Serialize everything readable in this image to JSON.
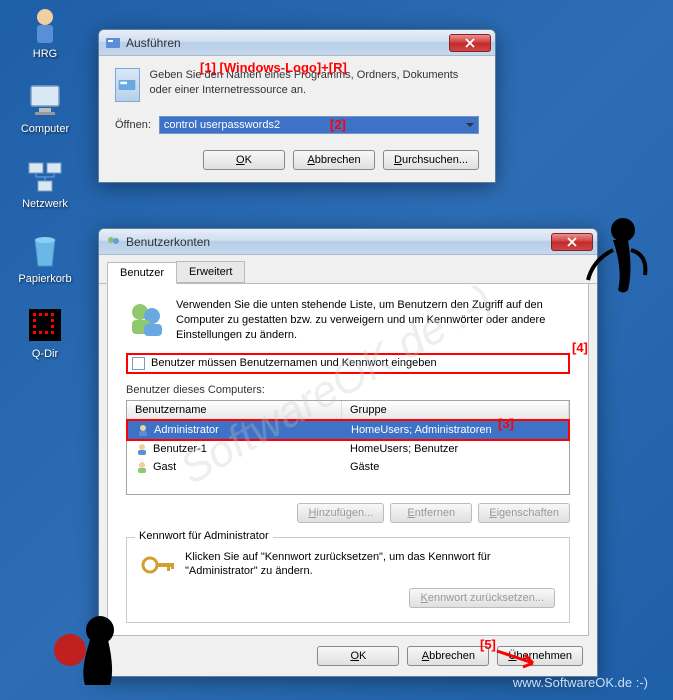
{
  "desktop": {
    "icons": [
      {
        "label": "HRG"
      },
      {
        "label": "Computer"
      },
      {
        "label": "Netzwerk"
      },
      {
        "label": "Papierkorb"
      },
      {
        "label": "Q-Dir"
      }
    ]
  },
  "run": {
    "title": "Ausführen",
    "description": "Geben Sie den Namen eines Programms, Ordners, Dokuments oder einer Internetressource an.",
    "open_label": "Öffnen:",
    "command": "control userpasswords2",
    "ok": "OK",
    "cancel": "Abbrechen",
    "browse": "Durchsuchen..."
  },
  "users": {
    "title": "Benutzerkonten",
    "tab1": "Benutzer",
    "tab2": "Erweitert",
    "intro": "Verwenden Sie die unten stehende Liste, um Benutzern den Zugriff auf den Computer zu gestatten bzw. zu verweigern und um Kennwörter oder andere Einstellungen zu ändern.",
    "checkbox_label": "Benutzer müssen Benutzernamen und Kennwort eingeben",
    "list_label": "Benutzer dieses Computers:",
    "col_user": "Benutzername",
    "col_group": "Gruppe",
    "rows": [
      {
        "name": "Administrator",
        "group": "HomeUsers; Administratoren"
      },
      {
        "name": "Benutzer-1",
        "group": "HomeUsers; Benutzer"
      },
      {
        "name": "Gast",
        "group": "Gäste"
      }
    ],
    "add": "Hinzufügen...",
    "remove": "Entfernen",
    "props": "Eigenschaften",
    "pw_group": "Kennwort für Administrator",
    "pw_text": "Klicken Sie auf \"Kennwort zurücksetzen\", um das Kennwort für \"Administrator\" zu ändern.",
    "pw_btn": "Kennwort zurücksetzen...",
    "ok": "OK",
    "cancel": "Abbrechen",
    "apply": "Übernehmen"
  },
  "annotations": {
    "a1": "[1] [Windows-Logo]+[R]",
    "a2": "[2]",
    "a3": "[3]",
    "a4": "[4]",
    "a5": "[5]"
  },
  "watermark": "SoftwareOK.de :-)",
  "footer": "www.SoftwareOK.de :-)"
}
